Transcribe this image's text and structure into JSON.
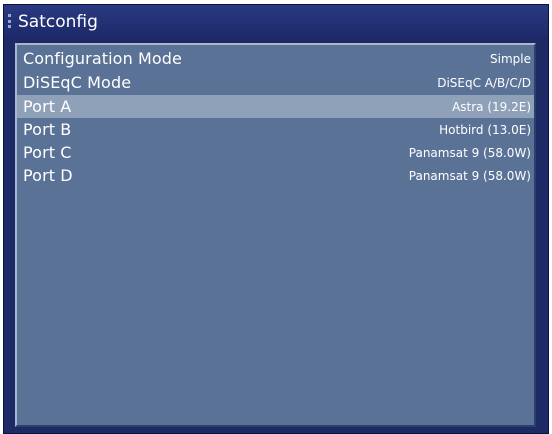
{
  "window": {
    "title": "Satconfig"
  },
  "settings": {
    "items": [
      {
        "label": "Configuration Mode",
        "value": "Simple",
        "selected": false
      },
      {
        "label": "DiSEqC Mode",
        "value": "DiSEqC A/B/C/D",
        "selected": false
      },
      {
        "label": "Port A",
        "value": "Astra (19.2E)",
        "selected": true
      },
      {
        "label": "Port B",
        "value": "Hotbird (13.0E)",
        "selected": false
      },
      {
        "label": "Port C",
        "value": "Panamsat 9 (58.0W)",
        "selected": false
      },
      {
        "label": "Port D",
        "value": "Panamsat 9 (58.0W)",
        "selected": false
      }
    ]
  },
  "colors": {
    "window_frame": "#1d2a66",
    "panel_background": "#5b7297",
    "selection_highlight": "#8fa0b9",
    "text": "#ffffff"
  }
}
